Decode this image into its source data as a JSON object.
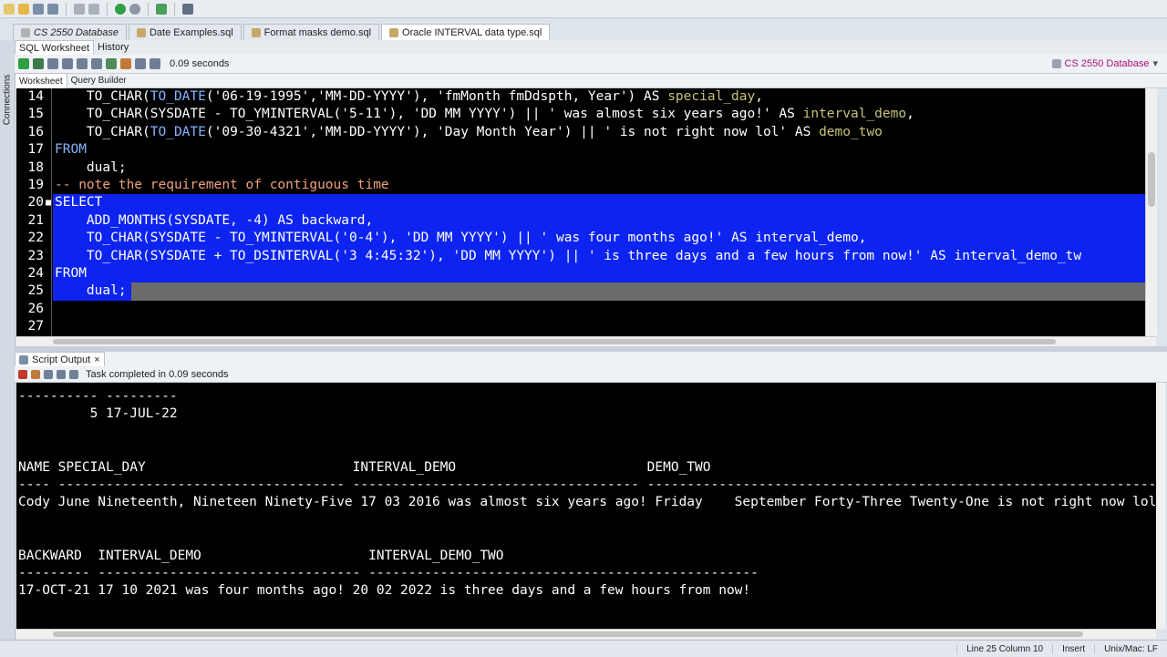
{
  "doc_tabs": [
    {
      "label": "CS 2550 Database",
      "italic": true,
      "active": false
    },
    {
      "label": "Date Examples.sql",
      "italic": false,
      "active": false
    },
    {
      "label": "Format masks demo.sql",
      "italic": false,
      "active": false
    },
    {
      "label": "Oracle INTERVAL data type.sql",
      "italic": false,
      "active": true
    }
  ],
  "side_strip": {
    "label": "Connections"
  },
  "subtabs": {
    "worksheet": "SQL Worksheet",
    "history": "History"
  },
  "ws_toolbar": {
    "time": "0.09 seconds",
    "connection": "CS 2550 Database"
  },
  "ws_views": {
    "worksheet": "Worksheet",
    "query_builder": "Query Builder"
  },
  "editor_lines": [
    {
      "n": "14",
      "tokens": [
        [
          "    TO_CHAR(",
          ""
        ],
        [
          "TO_DATE",
          "kw"
        ],
        [
          "('06-19-1995','MM-DD-YYYY'), 'fmMonth fmDdspth, Year') AS ",
          ""
        ],
        [
          "special_day",
          "alias"
        ],
        [
          ",",
          ""
        ]
      ]
    },
    {
      "n": "15",
      "tokens": [
        [
          "    TO_CHAR(SYSDATE - TO_YMINTERVAL('5-11'), 'DD MM YYYY') || ' was almost six years ago!' AS ",
          ""
        ],
        [
          "interval_demo",
          "alias"
        ],
        [
          ",",
          ""
        ]
      ]
    },
    {
      "n": "16",
      "tokens": [
        [
          "    TO_CHAR(",
          ""
        ],
        [
          "TO_DATE",
          "kw"
        ],
        [
          "('09-30-4321','MM-DD-YYYY'), 'Day Month Year') || ' is not right now lol' AS ",
          ""
        ],
        [
          "demo_two",
          "alias"
        ]
      ]
    },
    {
      "n": "17",
      "tokens": [
        [
          "FROM",
          "kw"
        ]
      ]
    },
    {
      "n": "18",
      "tokens": [
        [
          "    dual;",
          ""
        ]
      ]
    },
    {
      "n": "19",
      "tokens": [
        [
          "-- note the requirement of contiguous time",
          "cmt"
        ]
      ]
    },
    {
      "n": "20",
      "tokens": [
        [
          "SELECT",
          ""
        ]
      ]
    },
    {
      "n": "21",
      "tokens": [
        [
          "    ADD_MONTHS(SYSDATE, -4) AS backward,",
          ""
        ]
      ]
    },
    {
      "n": "22",
      "tokens": [
        [
          "    TO_CHAR(SYSDATE - TO_YMINTERVAL('0-4'), 'DD MM YYYY') || ' was four months ago!' AS interval_demo,",
          ""
        ]
      ]
    },
    {
      "n": "23",
      "tokens": [
        [
          "    TO_CHAR(SYSDATE + TO_DSINTERVAL('3 4:45:32'), 'DD MM YYYY') || ' is three days and a few hours from now!' AS interval_demo_tw",
          ""
        ]
      ]
    },
    {
      "n": "24",
      "tokens": [
        [
          "FROM",
          ""
        ]
      ]
    },
    {
      "n": "25",
      "tokens": [
        [
          "    dual;",
          ""
        ]
      ]
    },
    {
      "n": "26",
      "tokens": []
    },
    {
      "n": "27",
      "tokens": []
    }
  ],
  "output_tab": {
    "label": "Script Output",
    "close": "×",
    "task": "Task completed in 0.09 seconds"
  },
  "output_lines": [
    "---------- ---------",
    "         5 17-JUL-22",
    "",
    "",
    "NAME SPECIAL_DAY                          INTERVAL_DEMO                        DEMO_TWO",
    "---- ------------------------------------ ------------------------------------ ------------------------------------------------------------------------",
    "Cody June Nineteenth, Nineteen Ninety-Five 17 03 2016 was almost six years ago! Friday    September Forty-Three Twenty-One is not right now lol",
    "",
    "",
    "BACKWARD  INTERVAL_DEMO                     INTERVAL_DEMO_TWO",
    "--------- --------------------------------- -------------------------------------------------",
    "17-OCT-21 17 10 2021 was four months ago! 20 02 2022 is three days and a few hours from now!"
  ],
  "status": {
    "position": "Line 25 Column 10",
    "mode": "Insert",
    "eol": "Unix/Mac: LF"
  },
  "colors": {
    "selection": "#0d24f0",
    "keyword": "#86b5ff",
    "alias": "#c7c27a",
    "comment": "#f0a07a",
    "connection": "#b0127a"
  }
}
